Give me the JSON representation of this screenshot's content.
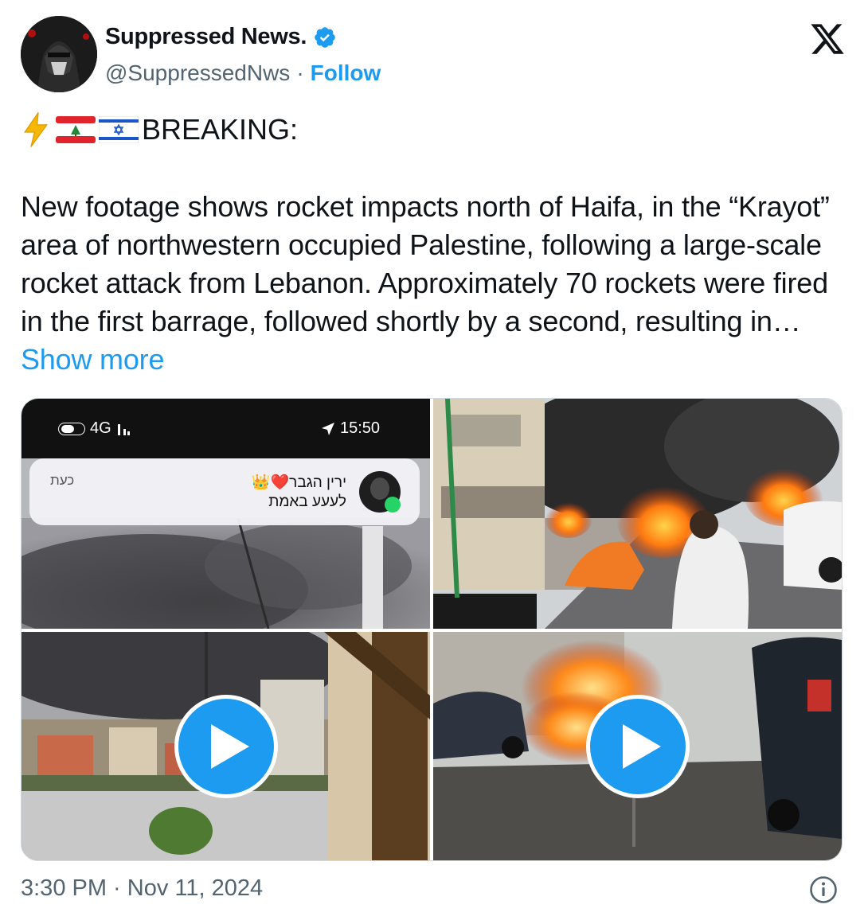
{
  "author": {
    "display_name": "Suppressed News.",
    "handle": "@SuppressedNws",
    "separator": "·",
    "follow_label": "Follow",
    "verified": true
  },
  "tweet": {
    "headline": "BREAKING:",
    "body": "New footage shows rocket impacts north of Haifa, in the “Krayot” area of northwestern occupied Palestine, following a large-scale rocket attack from Lebanon. Approximately 70 rockets were fired in the first barrage, followed shortly by a second, resulting in… ",
    "show_more_label": "Show more",
    "timestamp": "3:30 PM · Nov 11, 2024"
  },
  "media": {
    "phone_status": {
      "network": "4G",
      "time": "15:50"
    },
    "notification": {
      "time_label": "כעת",
      "line1": "ירין הגבר❤️👑",
      "line2": "לעעע באמת"
    }
  },
  "colors": {
    "accent": "#1d9bf0",
    "secondary_text": "#536471",
    "border": "#cfd9de"
  },
  "icons": {
    "brand": "x-logo-icon",
    "verified": "verified-badge-icon",
    "play": "play-icon",
    "info": "info-icon",
    "bolt": "lightning-icon",
    "flag_lb": "lebanon-flag-icon",
    "flag_il": "israel-flag-icon"
  }
}
